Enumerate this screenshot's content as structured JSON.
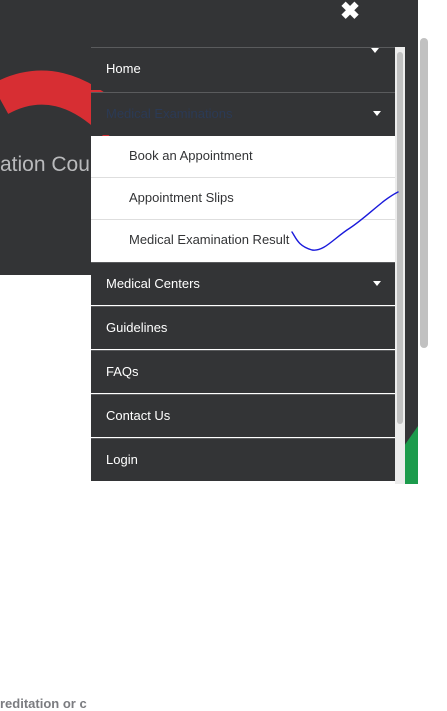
{
  "header": {
    "close_icon": "close-icon"
  },
  "background": {
    "hero_text": "ation Cour",
    "body_text": "reditation or c"
  },
  "menu": {
    "items": [
      {
        "label": "Home",
        "has_chevron": false
      },
      {
        "label": "Medical Examinations",
        "has_chevron": true,
        "expanded": true
      },
      {
        "label": "Medical Centers",
        "has_chevron": true
      },
      {
        "label": "Guidelines",
        "has_chevron": false
      },
      {
        "label": "FAQs",
        "has_chevron": false
      },
      {
        "label": "Contact Us",
        "has_chevron": false
      },
      {
        "label": "Login",
        "has_chevron": false
      }
    ],
    "submenu": [
      {
        "label": "Book an Appointment"
      },
      {
        "label": "Appointment Slips"
      },
      {
        "label": "Medical Examination Result"
      }
    ]
  },
  "colors": {
    "menu_bg": "#333436",
    "active_text": "#2b3a55",
    "hero_red": "#d72e33",
    "accent_green": "#1c9b4c",
    "annotation_blue": "#1a1adb"
  }
}
